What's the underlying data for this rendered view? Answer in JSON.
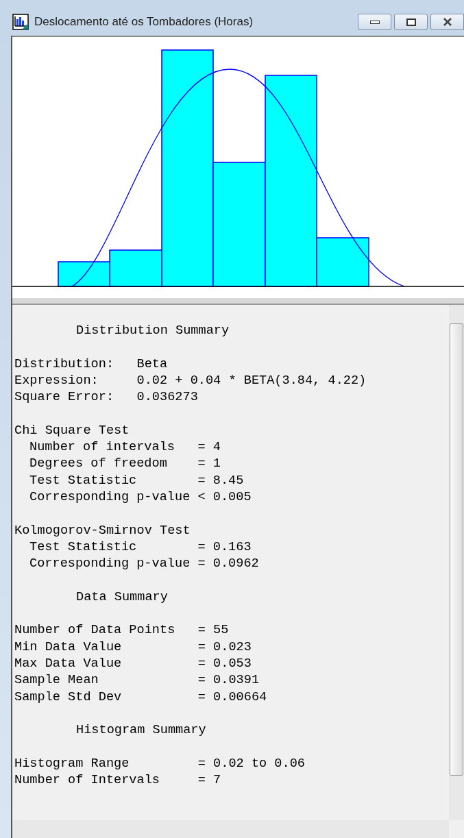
{
  "window": {
    "title": "Deslocamento até os Tombadores (Horas)"
  },
  "report": [
    {
      "lines": [
        {
          "kind": "heading",
          "text": "Distribution Summary"
        }
      ]
    },
    {
      "lines": [
        {
          "kind": "field",
          "text": "Distribution:   Beta"
        },
        {
          "kind": "field",
          "text": "Expression:     0.02 + 0.04 * BETA(3.84, 4.22)"
        },
        {
          "kind": "field",
          "text": "Square Error:   0.036273"
        }
      ]
    },
    {
      "lines": [
        {
          "kind": "field",
          "text": "Chi Square Test"
        },
        {
          "kind": "subfield",
          "text": "Number of intervals   = 4"
        },
        {
          "kind": "subfield",
          "text": "Degrees of freedom    = 1"
        },
        {
          "kind": "subfield",
          "text": "Test Statistic        = 8.45"
        },
        {
          "kind": "subfield",
          "text": "Corresponding p-value < 0.005"
        }
      ]
    },
    {
      "lines": [
        {
          "kind": "field",
          "text": "Kolmogorov-Smirnov Test"
        },
        {
          "kind": "subfield",
          "text": "Test Statistic        = 0.163"
        },
        {
          "kind": "subfield",
          "text": "Corresponding p-value = 0.0962"
        }
      ]
    },
    {
      "lines": [
        {
          "kind": "heading",
          "text": "Data Summary"
        }
      ]
    },
    {
      "lines": [
        {
          "kind": "field",
          "text": "Number of Data Points   = 55"
        },
        {
          "kind": "field",
          "text": "Min Data Value          = 0.023"
        },
        {
          "kind": "field",
          "text": "Max Data Value          = 0.053"
        },
        {
          "kind": "field",
          "text": "Sample Mean             = 0.0391"
        },
        {
          "kind": "field",
          "text": "Sample Std Dev          = 0.00664"
        }
      ]
    },
    {
      "lines": [
        {
          "kind": "heading",
          "text": "Histogram Summary"
        }
      ]
    },
    {
      "lines": [
        {
          "kind": "field",
          "text": "Histogram Range         = 0.02 to 0.06"
        },
        {
          "kind": "field",
          "text": "Number of Intervals     = 7"
        }
      ]
    }
  ]
}
